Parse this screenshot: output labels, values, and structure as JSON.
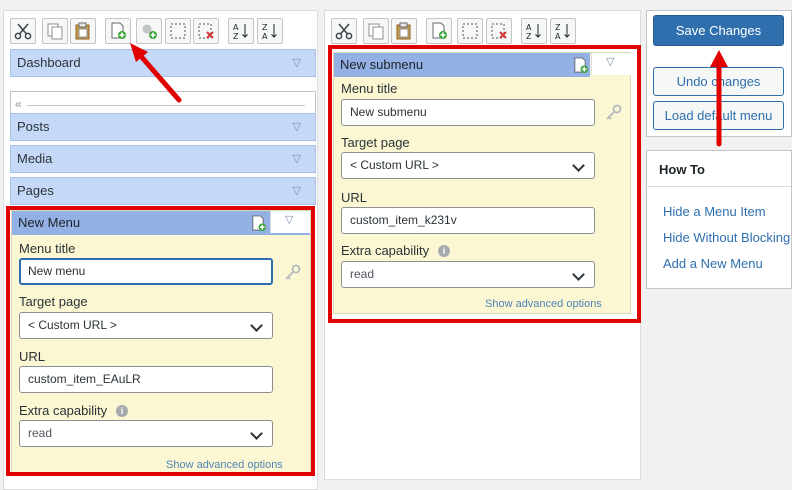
{
  "toolbar": {
    "buttons": [
      {
        "name": "cut-button",
        "icon": "scissors-icon"
      },
      {
        "name": "copy-button",
        "icon": "copy-icon"
      },
      {
        "name": "paste-button",
        "icon": "paste-icon"
      },
      {
        "name": "new-menu-button",
        "icon": "new-menu-icon"
      },
      {
        "name": "new-separator-button",
        "icon": "new-separator-icon"
      },
      {
        "name": "hide-button",
        "icon": "hide-dashed-icon"
      },
      {
        "name": "delete-button",
        "icon": "delete-doc-icon"
      },
      {
        "name": "sort-ascending-button",
        "icon": "sort-az-icon",
        "label": "A↓Z"
      },
      {
        "name": "sort-descending-button",
        "icon": "sort-za-icon",
        "label": "Z↓A"
      }
    ]
  },
  "menu_column": {
    "items": [
      {
        "label": "Dashboard"
      },
      {
        "label": "Posts"
      },
      {
        "label": "Media"
      },
      {
        "label": "Pages"
      }
    ],
    "separator_handle": "«",
    "expanded_item": {
      "title": "New Menu",
      "fields": {
        "menu_title_label": "Menu title",
        "menu_title_value": "New menu",
        "target_page_label": "Target page",
        "target_page_value": "< Custom URL >",
        "url_label": "URL",
        "url_value": "custom_item_EAuLR",
        "capability_label": "Extra capability",
        "capability_value": "read",
        "advanced_link": "Show advanced options"
      }
    }
  },
  "submenu_column": {
    "expanded_item": {
      "title": "New submenu",
      "fields": {
        "menu_title_label": "Menu title",
        "menu_title_value": "New submenu",
        "target_page_label": "Target page",
        "target_page_value": "< Custom URL >",
        "url_label": "URL",
        "url_value": "custom_item_k231v",
        "capability_label": "Extra capability",
        "capability_value": "read",
        "advanced_link": "Show advanced options"
      }
    }
  },
  "actions": {
    "save_label": "Save Changes",
    "undo_label": "Undo changes",
    "load_default_label": "Load default menu"
  },
  "how_to": {
    "title": "How To",
    "links": [
      "Hide a Menu Item",
      "Hide Without Blocking",
      "Add a New Menu"
    ]
  },
  "colors": {
    "highlight_red": "#e00000",
    "primary_blue": "#2f6fae",
    "menu_item_blue": "#c5d8f7",
    "editor_yellow": "#fbf7d2"
  }
}
